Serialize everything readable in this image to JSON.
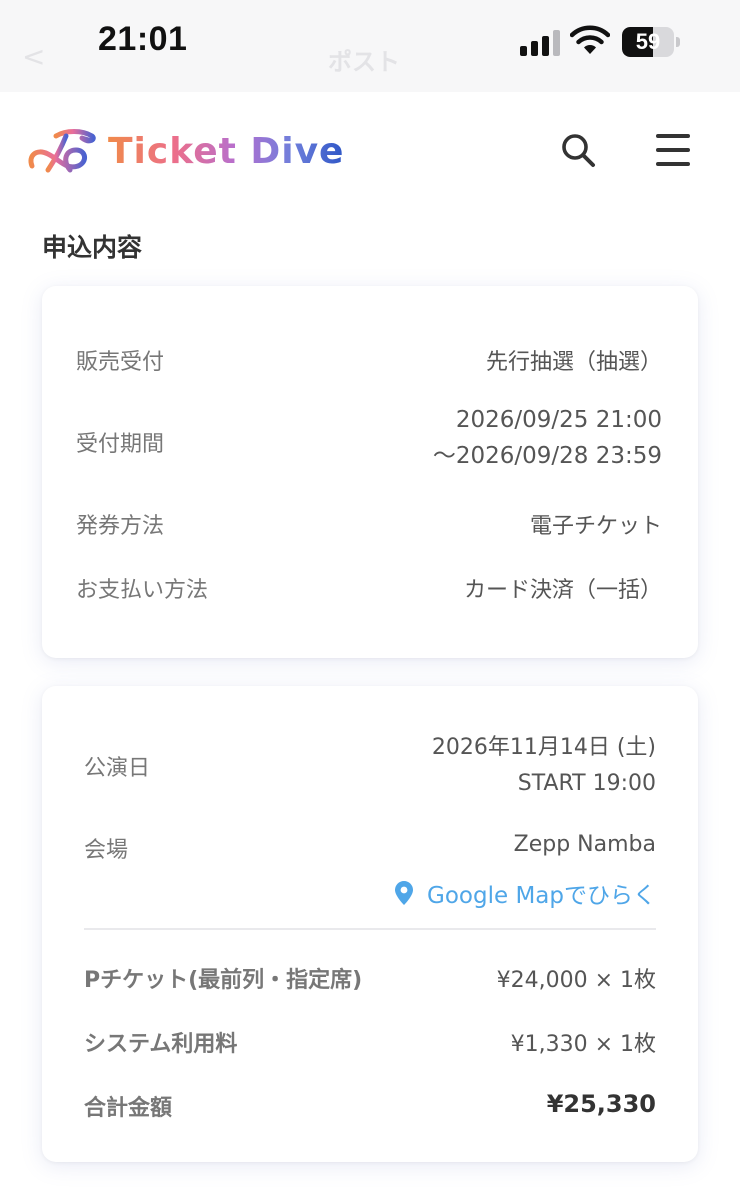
{
  "status_bar": {
    "time": "21:01",
    "ghost_back": "<",
    "ghost_title": "ポスト",
    "battery_level": "59",
    "battery_fraction": 0.59
  },
  "header": {
    "logo_text": "Ticket Dive",
    "search_icon": "search-icon",
    "menu_icon": "hamburger-menu-icon"
  },
  "section": {
    "title": "申込内容"
  },
  "application": {
    "sale_type_label": "販売受付",
    "sale_type_value": "先行抽選（抽選）",
    "period_label": "受付期間",
    "period_start": "2026/09/25 21:00",
    "period_end": "〜2026/09/28 23:59",
    "issue_label": "発券方法",
    "issue_value": "電子チケット",
    "payment_label": "お支払い方法",
    "payment_value": "カード決済（一括）"
  },
  "performance": {
    "date_label": "公演日",
    "date_value": "2026年11月14日 (土)",
    "start_value": "START 19:00",
    "venue_label": "会場",
    "venue_value": "Zepp Namba",
    "map_icon": "map-pin-icon",
    "map_link": "Google Mapでひらく",
    "ticket_label": "Pチケット(最前列・指定席)",
    "ticket_value": "¥24,000 × 1枚",
    "fee_label": "システム利用料",
    "fee_value": "¥1,330 × 1枚",
    "total_label": "合計金額",
    "total_value": "¥25,330"
  },
  "colors": {
    "link": "#4fa6e8",
    "logo_gradient": [
      "#f08a4b",
      "#ec6f8a",
      "#b56fd0",
      "#6f7fdb",
      "#2f57c7"
    ]
  }
}
